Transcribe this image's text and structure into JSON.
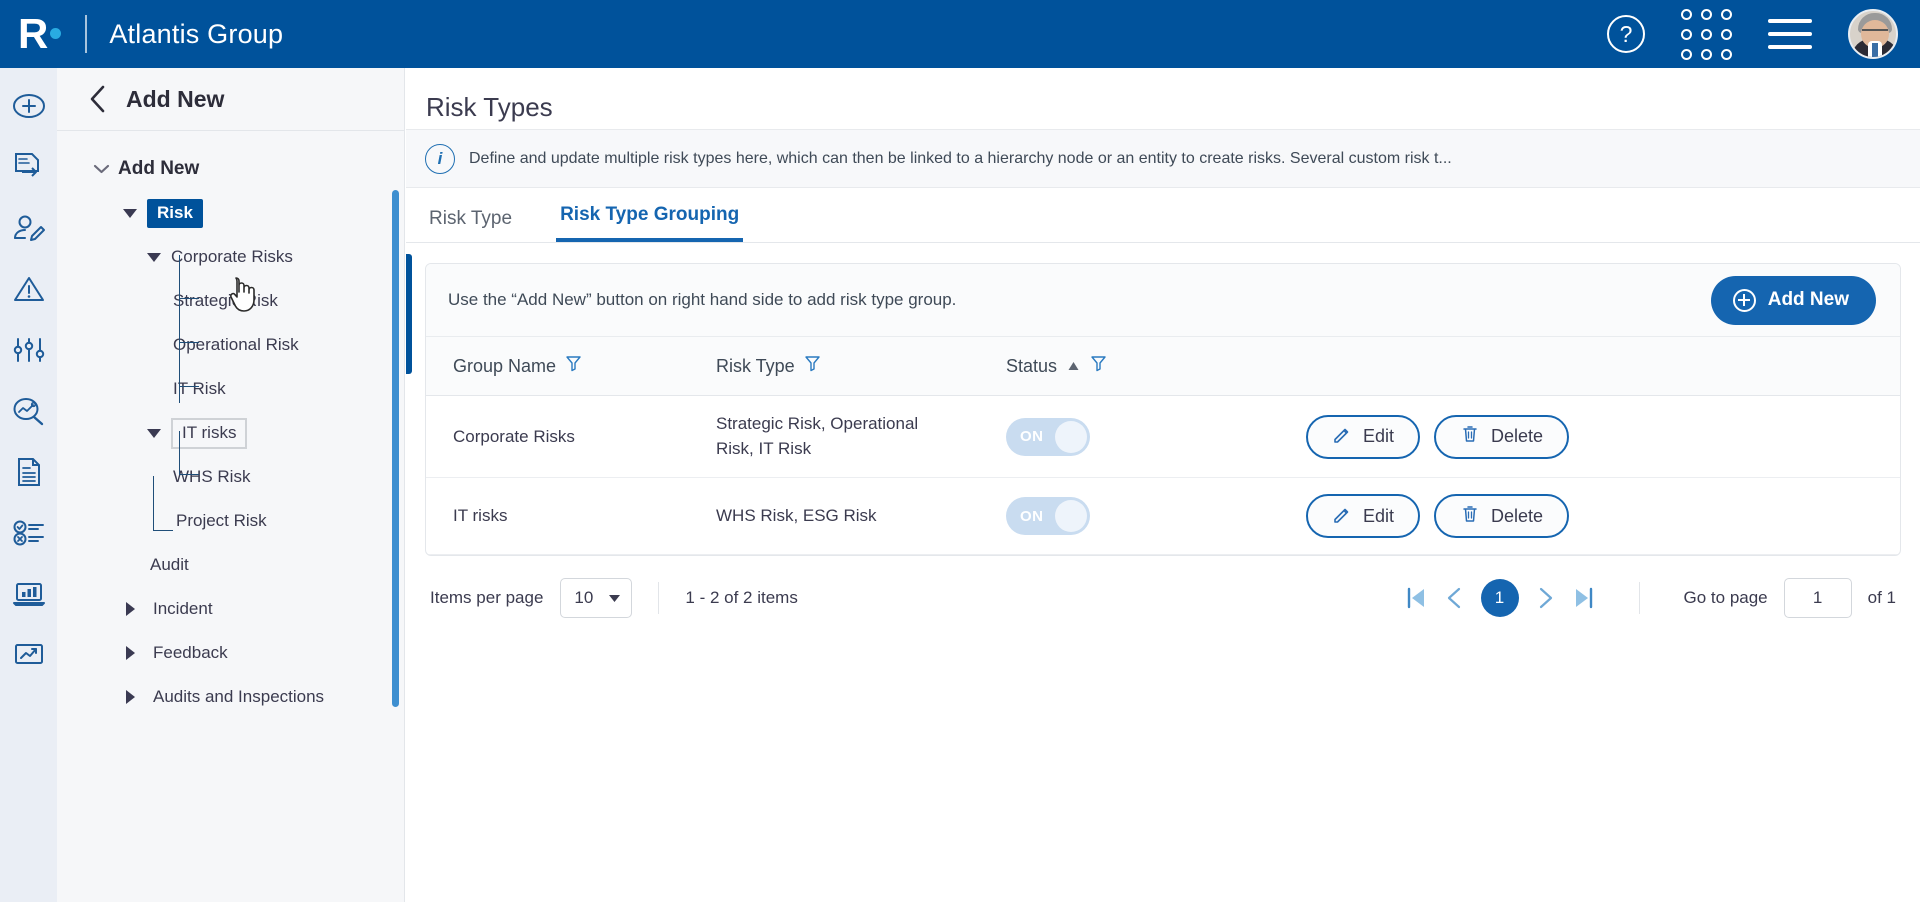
{
  "header": {
    "logo_letter": "R",
    "app_title": "Atlantis Group",
    "help_label": "?",
    "icons": [
      "help-icon",
      "apps-grid-icon",
      "menu-icon",
      "avatar"
    ]
  },
  "rail": {
    "items": [
      {
        "name": "add-icon"
      },
      {
        "name": "document-transfer-icon"
      },
      {
        "name": "person-edit-icon"
      },
      {
        "name": "warning-icon"
      },
      {
        "name": "settings-sliders-icon"
      },
      {
        "name": "analytics-search-icon"
      },
      {
        "name": "document-icon"
      },
      {
        "name": "checklist-icon"
      },
      {
        "name": "laptop-report-icon"
      },
      {
        "name": "trend-report-icon"
      }
    ]
  },
  "sidebar": {
    "back_title": "Add New",
    "tree": {
      "root": "Add New",
      "risk": "Risk",
      "corporate_risks": "Corporate Risks",
      "strategic_risk": "Strategic Risk",
      "operational_risk": "Operational Risk",
      "it_risk": "IT Risk",
      "it_risks": "IT risks",
      "whs_risk": "WHS Risk",
      "project_risk": "Project Risk",
      "audit": "Audit",
      "incident": "Incident",
      "feedback": "Feedback",
      "audits_and_inspections": "Audits and Inspections"
    }
  },
  "main": {
    "page_title": "Risk Types",
    "info_text": "Define and update multiple risk types here, which can then be linked to a hierarchy node or an entity to create risks. Several custom risk t...",
    "tabs": [
      {
        "label": "Risk Type",
        "active": false
      },
      {
        "label": "Risk Type Grouping",
        "active": true
      }
    ],
    "card": {
      "hint": "Use the “Add New” button on right hand side to add risk type group.",
      "add_new_label": "Add New"
    },
    "table": {
      "columns": [
        "Group Name",
        "Risk Type",
        "Status"
      ],
      "sort_column": "Status",
      "sort_direction": "asc",
      "rows": [
        {
          "group_name": "Corporate Risks",
          "risk_type": "Strategic Risk, Operational Risk, IT Risk",
          "status": "ON",
          "edit_label": "Edit",
          "delete_label": "Delete"
        },
        {
          "group_name": "IT risks",
          "risk_type": "WHS Risk, ESG Risk",
          "status": "ON",
          "edit_label": "Edit",
          "delete_label": "Delete"
        }
      ]
    },
    "pagination": {
      "items_per_page_label": "Items per page",
      "items_per_page_value": "10",
      "range_text": "1 - 2 of 2 items",
      "current_page": "1",
      "go_to_page_label": "Go to page",
      "go_to_page_value": "1",
      "of_pages": "of 1"
    }
  },
  "colors": {
    "brand_blue": "#00529B",
    "accent_blue": "#1565b0",
    "logo_dot": "#29ABE2",
    "rail_bg": "#eaeef5",
    "sidebar_bg": "#f6f7f9"
  }
}
